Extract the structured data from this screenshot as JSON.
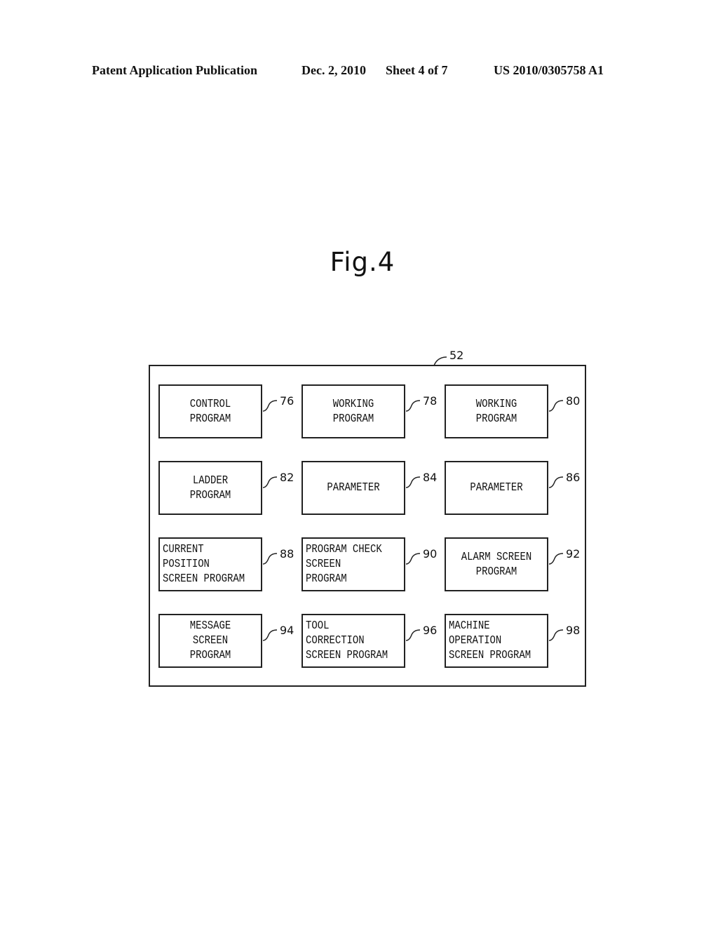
{
  "header": {
    "publication": "Patent Application Publication",
    "date": "Dec. 2, 2010",
    "sheet": "Sheet 4 of 7",
    "number": "US 2010/0305758 A1"
  },
  "figure": {
    "title": "Fig.4",
    "container_ref": "52",
    "blocks": [
      {
        "ref": "76",
        "lines": [
          "CONTROL",
          "PROGRAM"
        ]
      },
      {
        "ref": "78",
        "lines": [
          "WORKING",
          "PROGRAM"
        ]
      },
      {
        "ref": "80",
        "lines": [
          "WORKING",
          "PROGRAM"
        ]
      },
      {
        "ref": "82",
        "lines": [
          "LADDER",
          "PROGRAM"
        ]
      },
      {
        "ref": "84",
        "lines": [
          "PARAMETER"
        ]
      },
      {
        "ref": "86",
        "lines": [
          "PARAMETER"
        ]
      },
      {
        "ref": "88",
        "lines": [
          "CURRENT",
          "POSITION",
          "SCREEN PROGRAM"
        ]
      },
      {
        "ref": "90",
        "lines": [
          "PROGRAM CHECK",
          "SCREEN",
          "PROGRAM"
        ]
      },
      {
        "ref": "92",
        "lines": [
          "ALARM SCREEN",
          "PROGRAM"
        ]
      },
      {
        "ref": "94",
        "lines": [
          "MESSAGE",
          "SCREEN",
          "PROGRAM"
        ]
      },
      {
        "ref": "96",
        "lines": [
          "TOOL",
          "CORRECTION",
          "SCREEN PROGRAM"
        ]
      },
      {
        "ref": "98",
        "lines": [
          "MACHINE",
          "OPERATION",
          "SCREEN PROGRAM"
        ]
      }
    ]
  }
}
